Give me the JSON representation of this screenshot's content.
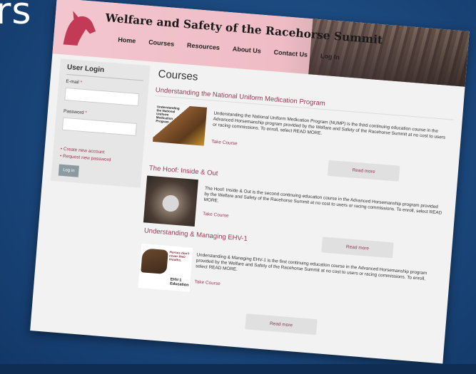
{
  "slide": {
    "title": "rs"
  },
  "site": {
    "name": "Welfare and Safety of the Racehorse Summit"
  },
  "nav": [
    "Home",
    "Courses",
    "Resources",
    "About Us",
    "Contact Us",
    "Log In"
  ],
  "sidebar": {
    "title": "User Login",
    "email_label": "E-mail",
    "password_label": "Password",
    "required_mark": "*",
    "links": [
      "Create new account",
      "Request new password"
    ],
    "login_button": "Log in"
  },
  "page": {
    "title": "Courses"
  },
  "courses": [
    {
      "title": "Understanding the National Uniform Medication Program",
      "image_caption": "Understanding the National Uniform Medication Program",
      "description": "Understanding the National Uniform Medication Program (NUMP) is the third continuing education course in the Advanced Horsemanship program provided by the Welfare and Safety of the Racehorse Summit at no cost to users or racing commissions. To enroll, select READ MORE.",
      "take_course": "Take Course",
      "read_more": "Read more"
    },
    {
      "title": "The Hoof: Inside & Out",
      "description": "The Hoof: Inside & Out is the second continuing education course in the Advanced Horsemanship program provided by the Welfare and Safety of the Racehorse Summit at no cost to users or racing commissions. To enroll, select READ MORE.",
      "take_course": "Take Course",
      "read_more": "Read more"
    },
    {
      "title": "Understanding & Managing EHV-1",
      "image_caption": "Horses don't cover their mouths.",
      "image_label": "EHV-1 Education",
      "description": "Understanding & Managing EHV-1 is the first continuing education course in the Advanced Horsemanship program provided by the Welfare and Safety of the Racehorse Summit at no cost to users or racing commissions. To enroll, select READ MORE.",
      "take_course": "Take Course",
      "read_more": "Read more"
    }
  ],
  "colors": {
    "accent": "#9c3a52",
    "header_pink": "#f3c6cf",
    "background": "#1c4a80"
  }
}
